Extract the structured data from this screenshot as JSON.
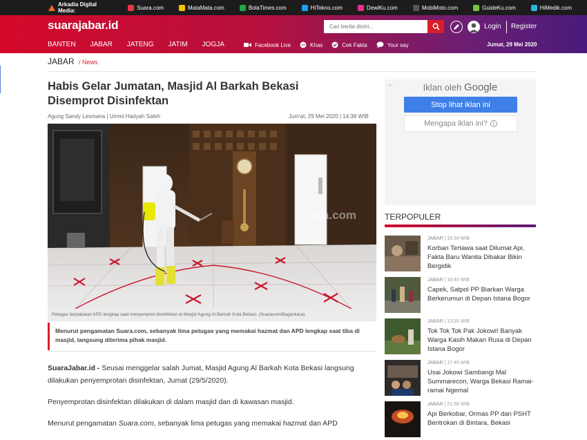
{
  "topbar": {
    "label": "Arkadia Digital Media:",
    "sites": [
      {
        "name": "Suara.com",
        "color": "#e53946"
      },
      {
        "name": "MataMata.com",
        "color": "#f5c400"
      },
      {
        "name": "BolaTimes.com",
        "color": "#23a54a"
      },
      {
        "name": "HiTekno.com",
        "color": "#1da1f2"
      },
      {
        "name": "DewiKu.com",
        "color": "#e6318c"
      },
      {
        "name": "MobiMoto.com",
        "color": "#555555"
      },
      {
        "name": "GuideKu.com",
        "color": "#7cc142"
      },
      {
        "name": "HiMedik.com",
        "color": "#29b6d6"
      }
    ]
  },
  "header": {
    "logo": "suarajabar.id",
    "search_placeholder": "Cari berita disini...",
    "login": "Login",
    "register": "Register",
    "nav": [
      "BANTEN",
      "JABAR",
      "JATENG",
      "JATIM",
      "JOGJA"
    ],
    "subnav": [
      {
        "label": "Facebook Live",
        "icon": "video-icon"
      },
      {
        "label": "Khas",
        "icon": "chat-icon"
      },
      {
        "label": "Cek Fakta",
        "icon": "check-icon"
      },
      {
        "label": "Your say",
        "icon": "speech-icon"
      }
    ],
    "date": "Jumat, 29 Mei 2020"
  },
  "breadcrumb": {
    "section": "JABAR",
    "sub": "/ News"
  },
  "article": {
    "title": "Habis Gelar Jumatan, Masjid Al Barkah Bekasi Disemprot Disinfektan",
    "authors": "Agung Sandy Lesmana | Ummi Hadyah Saleh",
    "published": "Jum'at, 29 Mei 2020 | 14:38 WIB",
    "watermark": "suara.com",
    "caption": "Petugas berpakaian APD lengkap saat menyemprot disinfektan di Masjid Agung Al Barkah Kota Bekasi. (Suaracom/Bagaskara).",
    "lead": "Menurut pengamatan Suara.com, sebanyak lima petugas yang memakai hazmat dan APD lengkap saat tiba di masjid, langsung diterima pihak masjid.",
    "p1_source": "SuaraJabar.id -",
    "p1_text": " Seusai menggelar salah Jumat, Masjid Agung Al Barkah Kota Bekasi langsung dilakukan penyemprotan disinfektan, Jumat (29/5/2020).",
    "p2": "Penyemprotan disinfektan dilakukan di dalam masjid dan di kawasan masjid.",
    "p3_start": "Menurut pengamatan ",
    "p3_em": "Suara.com",
    "p3_end": ", sebanyak lima petugas yang memakai hazmat dan APD"
  },
  "ad": {
    "label": "Iklan oleh",
    "brand": "Google",
    "stop": "Stop lihat iklan ini",
    "why": "Mengapa iklan ini?"
  },
  "terpopuler": {
    "heading": "TERPOPULER",
    "items": [
      {
        "section": "JABAR",
        "time": "| 16:34 WIB",
        "title": "Korban Tertawa saat Dilumat Api, Fakta Baru Wanita Dibakar Bikin Bergidik"
      },
      {
        "section": "JABAR",
        "time": "| 16:40 WIB",
        "title": "Capek, Satpol PP Biarkan Warga Berkerumun di Depan Istana Bogor"
      },
      {
        "section": "JABAR",
        "time": "| 13:35 WIB",
        "title": "Tok Tok Tok Pak Jokowi! Banyak Warga Kasih Makan Rusa di Depan Istana Bogor"
      },
      {
        "section": "JABAR",
        "time": "| 17:45 WIB",
        "title": "Usai Jokowi Sambangi Mal Summarecon, Warga Bekasi Ramai-ramai Ngemal"
      },
      {
        "section": "JABAR",
        "time": "| 21:39 WIB",
        "title": "Api Berkobar, Ormas PP dan PSHT Bentrokan di Bintara, Bekasi"
      }
    ]
  }
}
